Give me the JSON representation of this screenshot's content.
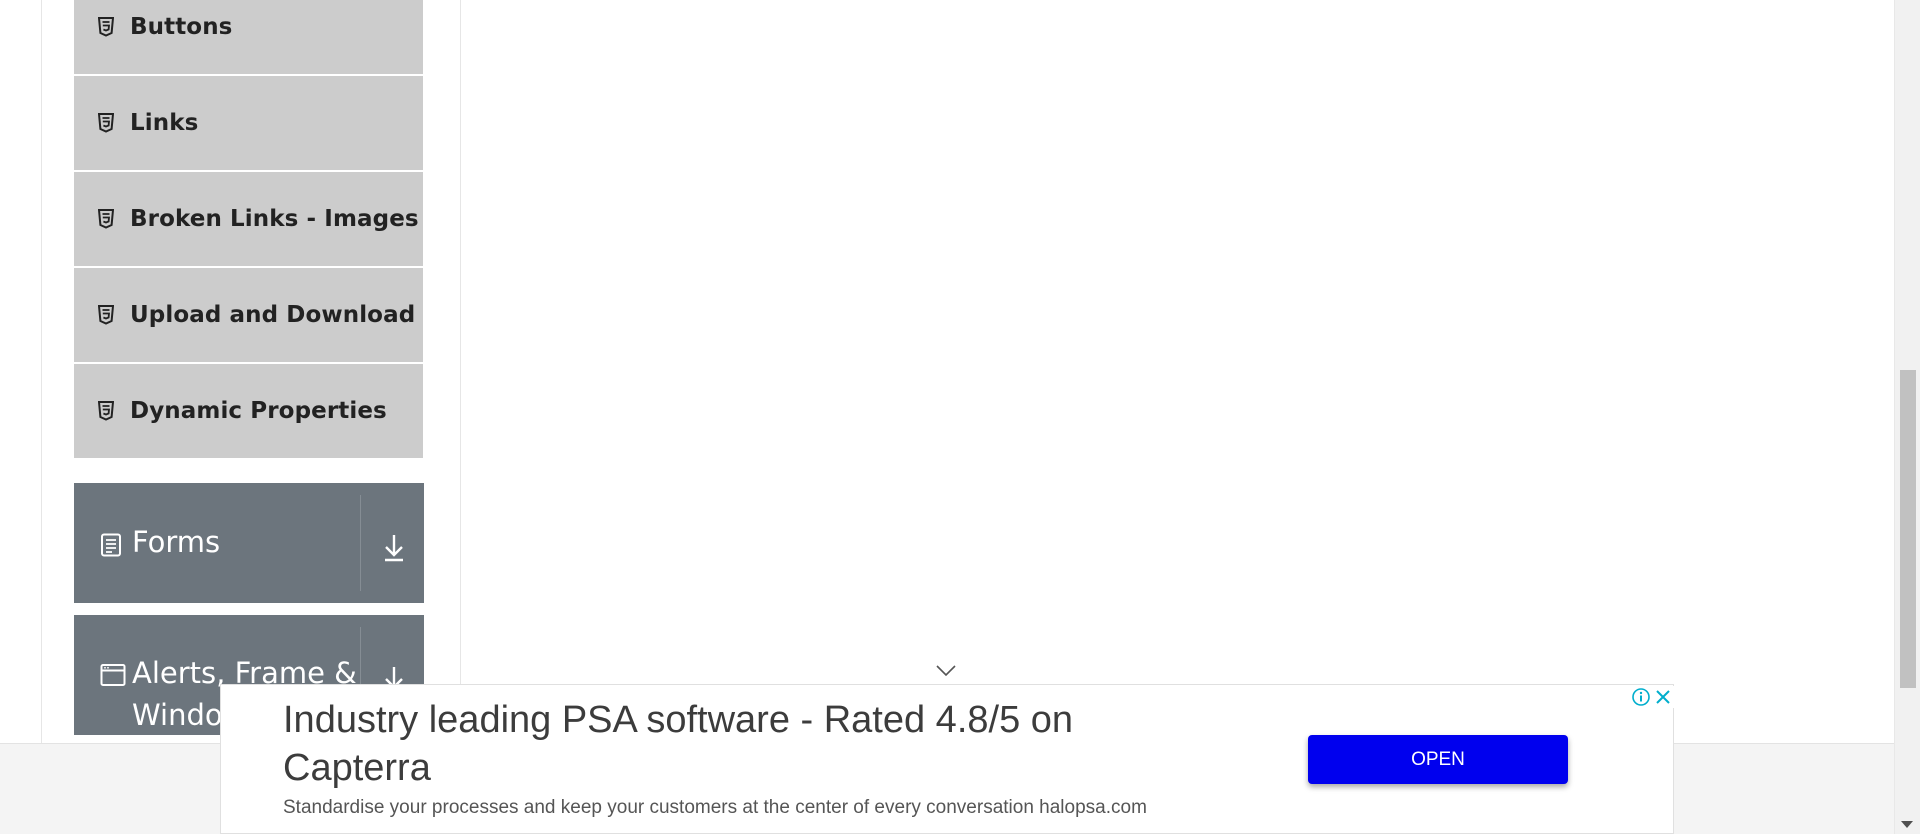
{
  "sidebar": {
    "element_items": [
      {
        "label": "Buttons",
        "icon": "html5-icon"
      },
      {
        "label": "Links",
        "icon": "html5-icon"
      },
      {
        "label": "Broken Links - Images",
        "icon": "html5-icon"
      },
      {
        "label": "Upload and Download",
        "icon": "html5-icon"
      },
      {
        "label": "Dynamic Properties",
        "icon": "html5-icon"
      }
    ],
    "groups": [
      {
        "title": "Forms",
        "icon": "form-list-icon"
      },
      {
        "title": "Alerts, Frame & Windows",
        "icon": "browser-window-icon"
      }
    ]
  },
  "ad": {
    "headline": "Industry leading PSA software - Rated 4.8/5 on Capterra",
    "description": "Standardise your processes and keep your customers at the center of every conversation halopsa.com",
    "cta_label": "OPEN",
    "cta_color": "#0000ee"
  },
  "colors": {
    "menu_item_bg": "#cccccc",
    "group_header_bg": "#6c757d"
  }
}
